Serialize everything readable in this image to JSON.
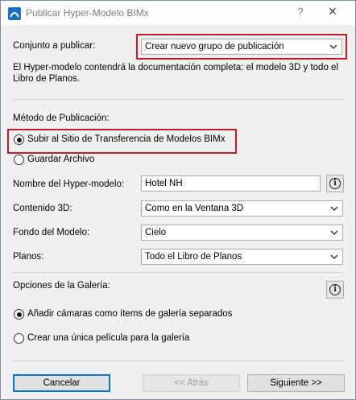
{
  "window": {
    "title": "Publicar Hyper-Modelo BIMx",
    "help_label": "?",
    "close_label": "✕"
  },
  "publish_set": {
    "label": "Conjunto a publicar:",
    "value": "Crear nuevo grupo de publicación"
  },
  "description": {
    "line1": "El Hyper-modelo contendrá la documentación completa: el modelo 3D y todo el",
    "line2": "Libro de Planos."
  },
  "method": {
    "heading": "Método de Publicación:",
    "options": [
      {
        "label": "Subir al Sitio de Transferencia de Modelos BIMx",
        "selected": true
      },
      {
        "label": "Guardar Archivo",
        "selected": false
      }
    ]
  },
  "fields": {
    "model_name": {
      "label": "Nombre del Hyper-modelo:",
      "value": "Hotel NH"
    },
    "content_3d": {
      "label": "Contenido 3D:",
      "value": "Como en la Ventana 3D"
    },
    "background": {
      "label": "Fondo del Modelo:",
      "value": "Cielo"
    },
    "plans": {
      "label": "Planos:",
      "value": "Todo el Libro de Planos"
    }
  },
  "gallery": {
    "heading": "Opciones de la Galería:",
    "options": [
      {
        "label": "Añadir cámaras como ítems de galería separados",
        "selected": true
      },
      {
        "label": "Crear una única película para la galería",
        "selected": false
      }
    ]
  },
  "buttons": {
    "cancel": "Cancelar",
    "back": "<< Atrás",
    "next": "Siguiente >>"
  },
  "colors": {
    "highlight": "#c51a2a",
    "primary_border": "#0078d7"
  }
}
